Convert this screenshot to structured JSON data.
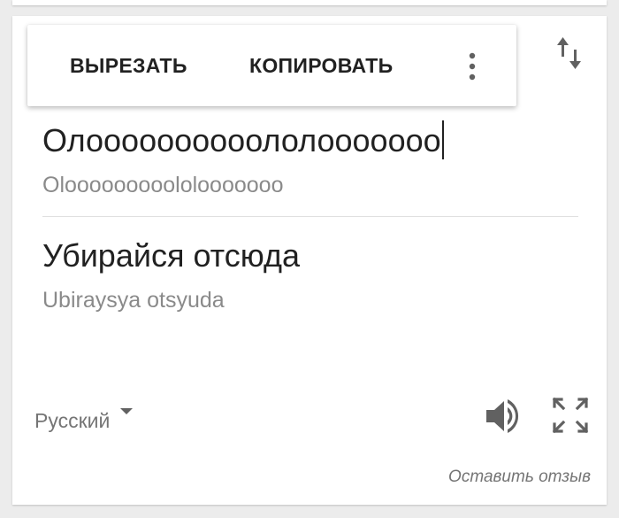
{
  "context_menu": {
    "cut_label": "ВЫРЕЗАТЬ",
    "copy_label": "КОПИРОВАТЬ",
    "more_icon": "more-vert-icon"
  },
  "toolbar": {
    "swap_icon": "swap-languages-icon"
  },
  "source": {
    "text": "Олоооооооооололооооооо",
    "transliteration": "Olooooooooololooooooo"
  },
  "translation": {
    "text": "Убирайся отсюда",
    "transliteration": "Ubiraysya otsyuda"
  },
  "footer": {
    "language_label": "Русский",
    "speaker_icon": "volume-up-icon",
    "fullscreen_icon": "fullscreen-icon",
    "feedback_label": "Оставить отзыв"
  },
  "colors": {
    "primary_text": "#212121",
    "secondary_text": "#8a8a8a",
    "icon": "#616161",
    "background": "#ececec",
    "card": "#ffffff"
  }
}
